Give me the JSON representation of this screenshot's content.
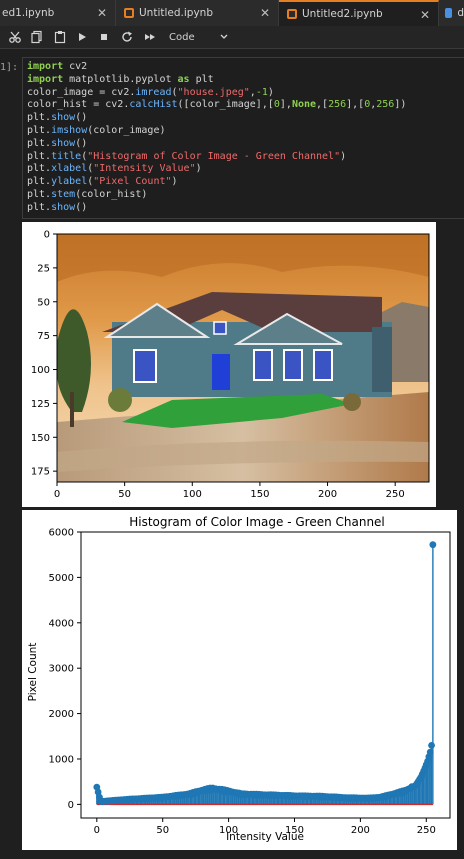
{
  "tabs": [
    {
      "label": "ed1.ipynb",
      "active": false
    },
    {
      "label": "Untitled.ipynb",
      "active": false
    },
    {
      "label": "Untitled2.ipynb",
      "active": true
    },
    {
      "label": "d",
      "active": false
    }
  ],
  "toolbar": {
    "cell_type": "Code",
    "icons": [
      "scissors-icon",
      "copy-icon",
      "paste-icon",
      "run-icon",
      "stop-icon",
      "restart-icon",
      "run-all-icon"
    ]
  },
  "cell": {
    "prompt": "1]:",
    "lines": [
      "import cv2",
      "import matplotlib.pyplot as plt",
      "color_image = cv2.imread(\"house.jpeg\",-1)",
      "color_hist = cv2.calcHist([color_image],[0],None,[256],[0,256])",
      "plt.show()",
      "plt.imshow(color_image)",
      "plt.show()",
      "plt.title(\"Histogram of Color Image - Green Channel\")",
      "plt.xlabel(\"Intensity Value\")",
      "plt.ylabel(\"Pixel Count\")",
      "plt.stem(color_hist)",
      "plt.show()"
    ]
  },
  "image_plot": {
    "xticks": [
      "0",
      "50",
      "100",
      "150",
      "200",
      "250"
    ],
    "yticks": [
      "0",
      "25",
      "50",
      "75",
      "100",
      "125",
      "150",
      "175"
    ],
    "xlim": [
      0,
      275
    ],
    "ylim": [
      183,
      0
    ]
  },
  "chart_data": {
    "type": "stem",
    "title": "Histogram of Color Image - Green Channel",
    "xlabel": "Intensity Value",
    "ylabel": "Pixel Count",
    "xlim": [
      -12,
      268
    ],
    "ylim": [
      -300,
      6000
    ],
    "xticks": [
      "0",
      "50",
      "100",
      "150",
      "200",
      "250"
    ],
    "yticks": [
      "0",
      "1000",
      "2000",
      "3000",
      "4000",
      "5000",
      "6000"
    ],
    "baseline_color": "#d62728",
    "stem_color": "#1f77b4",
    "points": [
      [
        0,
        380
      ],
      [
        3,
        60
      ],
      [
        20,
        100
      ],
      [
        50,
        150
      ],
      [
        70,
        220
      ],
      [
        80,
        300
      ],
      [
        87,
        340
      ],
      [
        95,
        310
      ],
      [
        110,
        220
      ],
      [
        130,
        200
      ],
      [
        150,
        180
      ],
      [
        170,
        170
      ],
      [
        190,
        140
      ],
      [
        205,
        130
      ],
      [
        215,
        150
      ],
      [
        225,
        220
      ],
      [
        235,
        300
      ],
      [
        242,
        420
      ],
      [
        246,
        600
      ],
      [
        249,
        800
      ],
      [
        251,
        950
      ],
      [
        253,
        1150
      ],
      [
        254,
        1300
      ],
      [
        255,
        5720
      ]
    ]
  }
}
